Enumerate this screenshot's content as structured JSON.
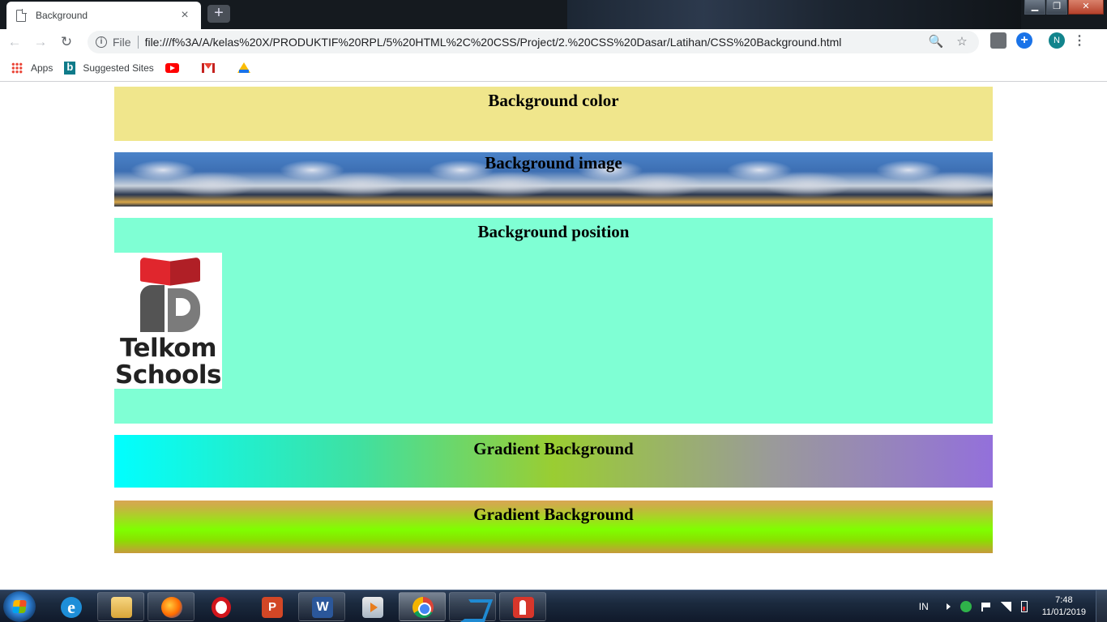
{
  "browser": {
    "tab_title": "Background",
    "tab_close": "×",
    "new_tab": "+",
    "window_controls": {
      "minimize": "▁",
      "maximize": "❐",
      "close": "✕"
    },
    "nav": {
      "back": "←",
      "forward": "→",
      "reload": "↻"
    },
    "address": {
      "scheme_label": "File",
      "url": "file:///f%3A/A/kelas%20X/PRODUKTIF%20RPL/5%20HTML%2C%20CSS/Project/2.%20CSS%20Dasar/Latihan/CSS%20Background.html"
    },
    "omni_icons": {
      "zoom": "🔍",
      "bookmark_star": "☆"
    },
    "profile_initial": "N",
    "menu": "⋮",
    "bookmarks": [
      {
        "label": "Apps",
        "icon": "apps-grid-icon"
      },
      {
        "label": "Suggested Sites",
        "icon": "bing-icon"
      },
      {
        "label": "",
        "icon": "youtube-icon"
      },
      {
        "label": "",
        "icon": "gmail-icon"
      },
      {
        "label": "",
        "icon": "google-drive-icon"
      }
    ]
  },
  "page": {
    "sections": [
      {
        "heading": "Background color",
        "color": "#f0e68c"
      },
      {
        "heading": "Background image"
      },
      {
        "heading": "Background position",
        "color": "#7fffd4"
      },
      {
        "heading": "Gradient Background",
        "colors": [
          "#00ffff",
          "#9acd32",
          "#9370db"
        ]
      },
      {
        "heading": "Gradient Background",
        "colors": [
          "#d9a653",
          "#7fff00",
          "#c79a3c"
        ]
      }
    ],
    "logo": {
      "line1": "Telkom",
      "line2": "Schools"
    }
  },
  "taskbar": {
    "apps": [
      {
        "name": "internet-explorer",
        "glyph": "e"
      },
      {
        "name": "file-explorer"
      },
      {
        "name": "firefox"
      },
      {
        "name": "opera"
      },
      {
        "name": "powerpoint",
        "glyph": "P"
      },
      {
        "name": "word",
        "glyph": "W"
      },
      {
        "name": "media-player"
      },
      {
        "name": "chrome",
        "active": true
      },
      {
        "name": "vscode"
      },
      {
        "name": "acrobat"
      }
    ],
    "tray": {
      "language": "IN",
      "time": "7:48",
      "date": "11/01/2019"
    }
  }
}
